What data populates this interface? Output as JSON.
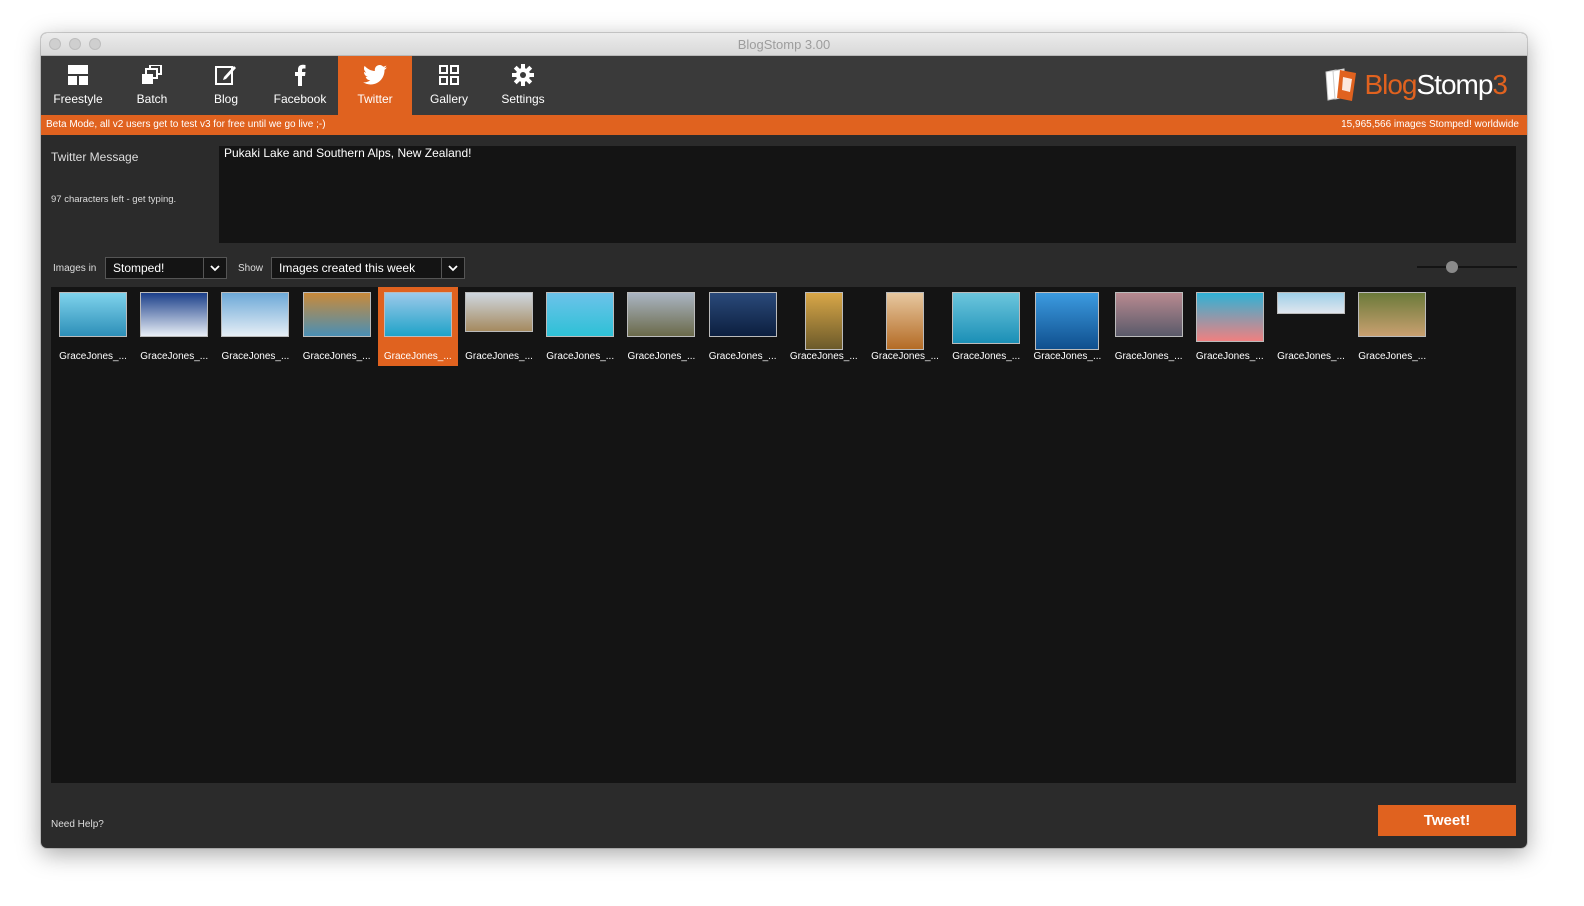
{
  "window": {
    "title": "BlogStomp 3.00"
  },
  "toolbar": {
    "tabs": [
      {
        "label": "Freestyle",
        "icon": "freestyle-icon"
      },
      {
        "label": "Batch",
        "icon": "batch-icon"
      },
      {
        "label": "Blog",
        "icon": "edit-icon"
      },
      {
        "label": "Facebook",
        "icon": "facebook-icon"
      },
      {
        "label": "Twitter",
        "icon": "twitter-icon",
        "active": true
      },
      {
        "label": "Gallery",
        "icon": "gallery-grid-icon"
      },
      {
        "label": "Settings",
        "icon": "gear-icon"
      }
    ],
    "logo": {
      "part1": "Blog",
      "part2": "Stomp",
      "part3": "3"
    }
  },
  "banner": {
    "left": "Beta Mode, all v2 users get to test v3 for free until we go live ;-)",
    "right": "15,965,566 images Stomped! worldwide"
  },
  "message": {
    "label": "Twitter Message",
    "chars_left": "97 characters left - get typing.",
    "text": "Pukaki Lake and Southern Alps, New Zealand!"
  },
  "filters": {
    "images_in_label": "Images in",
    "images_in_value": "Stomped!",
    "show_label": "Show",
    "show_value": "Images created this week"
  },
  "thumbnail_size": 0.35,
  "gallery": {
    "selected_index": 4,
    "items": [
      {
        "caption": "GraceJones_...",
        "colors": [
          "#7fd3ec",
          "#2d8fb8"
        ]
      },
      {
        "caption": "GraceJones_...",
        "colors": [
          "#1b3f8a",
          "#e8eef6"
        ]
      },
      {
        "caption": "GraceJones_...",
        "colors": [
          "#6da9d8",
          "#e6eef5"
        ]
      },
      {
        "caption": "GraceJones_...",
        "colors": [
          "#c98a3a",
          "#4a8fb5"
        ]
      },
      {
        "caption": "GraceJones_...",
        "colors": [
          "#9cc9ea",
          "#1fa3c8"
        ]
      },
      {
        "caption": "GraceJones_...",
        "colors": [
          "#cfd7e0",
          "#a58a5f"
        ]
      },
      {
        "caption": "GraceJones_...",
        "colors": [
          "#6cc2ea",
          "#2ec1d6"
        ]
      },
      {
        "caption": "GraceJones_...",
        "colors": [
          "#aab5c3",
          "#6b6a4a"
        ]
      },
      {
        "caption": "GraceJones_...",
        "colors": [
          "#2a4a7a",
          "#0c1f3f"
        ]
      },
      {
        "caption": "GraceJones_...",
        "colors": [
          "#d9a748",
          "#6b5a2a"
        ]
      },
      {
        "caption": "GraceJones_...",
        "colors": [
          "#e7c8a0",
          "#b46b25"
        ]
      },
      {
        "caption": "GraceJones_...",
        "colors": [
          "#6cc6dd",
          "#1b8fb6"
        ]
      },
      {
        "caption": "GraceJones_...",
        "colors": [
          "#3c9be0",
          "#0f4f8e"
        ]
      },
      {
        "caption": "GraceJones_...",
        "colors": [
          "#b88a90",
          "#5a5a6a"
        ]
      },
      {
        "caption": "GraceJones_...",
        "colors": [
          "#2fb2d6",
          "#f08080"
        ]
      },
      {
        "caption": "GraceJones_...",
        "colors": [
          "#9ecfe8",
          "#e0e6ee"
        ]
      },
      {
        "caption": "GraceJones_...",
        "colors": [
          "#6b7a3a",
          "#c9a070"
        ]
      }
    ]
  },
  "footer": {
    "help": "Need Help?",
    "tweet_button": "Tweet!"
  }
}
